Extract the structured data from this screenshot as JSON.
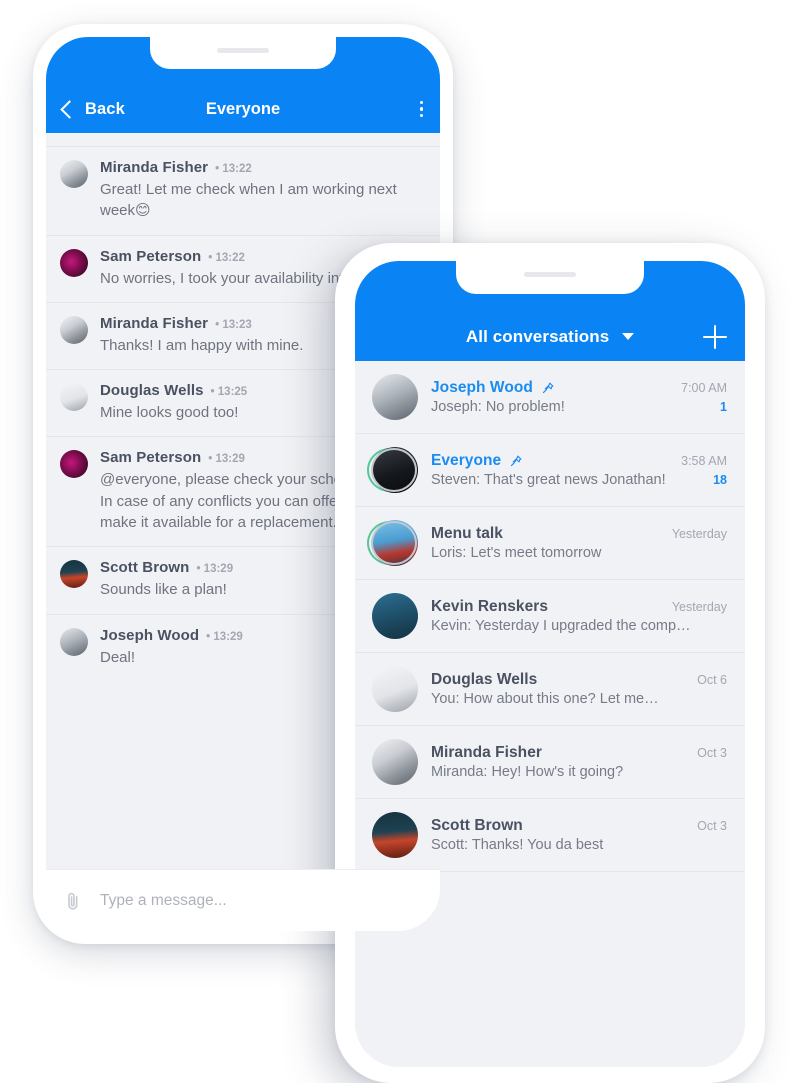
{
  "thread_screen": {
    "appbar": {
      "back_label": "Back",
      "title": "Everyone",
      "back_icon": "chevron-left-icon",
      "menu_icon": "kebab-menu-icon"
    },
    "messages": [
      {
        "name": "Miranda Fisher",
        "time": "13:22",
        "text": "Great! Let me check when I am working next week😊"
      },
      {
        "name": "Sam Peterson",
        "time": "13:22",
        "text": "No worries, I took your availability into account."
      },
      {
        "name": "Miranda Fisher",
        "time": "13:23",
        "text": "Thanks! I am happy with mine."
      },
      {
        "name": "Douglas Wells",
        "time": "13:25",
        "text": "Mine looks good too!"
      },
      {
        "name": "Sam Peterson",
        "time": "13:29",
        "text": "@everyone, please check your schedule today. In case of any conflicts you can offer a shift or make it available for a replacement."
      },
      {
        "name": "Scott Brown",
        "time": "13:29",
        "text": "Sounds like a plan!"
      },
      {
        "name": "Joseph Wood",
        "time": "13:29",
        "text": "Deal!"
      }
    ],
    "composer": {
      "attach_icon": "paperclip-icon",
      "placeholder": "Type a message..."
    }
  },
  "list_screen": {
    "appbar": {
      "title": "All conversations",
      "dropdown_icon": "chevron-down-icon",
      "add_icon": "plus-icon"
    },
    "conversations": [
      {
        "name": "Joseph Wood",
        "pinned": true,
        "unread": true,
        "time": "7:00 AM",
        "preview": "Joseph: No problem!",
        "badge": "1"
      },
      {
        "name": "Everyone",
        "pinned": true,
        "unread": true,
        "time": "3:58 AM",
        "preview": "Steven: That's great news Jonathan!",
        "badge": "18",
        "group": true
      },
      {
        "name": "Menu talk",
        "pinned": false,
        "unread": false,
        "time": "Yesterday",
        "preview": "Loris: Let's meet tomorrow",
        "badge": "",
        "group": true
      },
      {
        "name": "Kevin Renskers",
        "pinned": false,
        "unread": false,
        "time": "Yesterday",
        "preview": "Kevin: Yesterday I upgraded the comp…",
        "badge": ""
      },
      {
        "name": "Douglas Wells",
        "pinned": false,
        "unread": false,
        "time": "Oct 6",
        "preview": "You: How about this one? Let me…",
        "badge": ""
      },
      {
        "name": "Miranda Fisher",
        "pinned": false,
        "unread": false,
        "time": "Oct 3",
        "preview": "Miranda: Hey! How's it going?",
        "badge": ""
      },
      {
        "name": "Scott Brown",
        "pinned": false,
        "unread": false,
        "time": "Oct 3",
        "preview": "Scott: Thanks! You da best",
        "badge": ""
      }
    ]
  },
  "colors": {
    "accent": "#0a84f5",
    "link": "#1a8cf0",
    "screen_bg": "#f1f2f5",
    "name_text": "#4a5161",
    "body_text": "#6e737f",
    "meta_text": "#a2a7b2",
    "divider": "#e4e6ea"
  }
}
